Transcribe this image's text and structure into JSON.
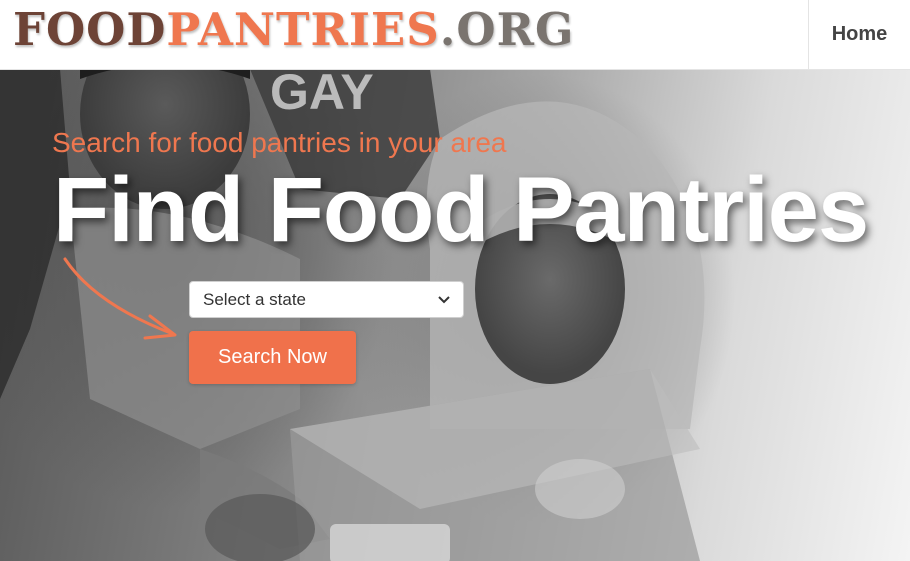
{
  "header": {
    "logo": {
      "part1": "FOOD",
      "part2": "PANTRIES",
      "part3": ".ORG"
    },
    "nav_home": "Home"
  },
  "hero": {
    "tagline": "Search for food pantries in your area",
    "headline": "Find Food Pantries",
    "state_select": {
      "selected": "Select a state"
    },
    "search_button": "Search Now",
    "accent_color": "#ef774f"
  },
  "icons": [
    "chevron-down-icon",
    "arrow-icon"
  ]
}
